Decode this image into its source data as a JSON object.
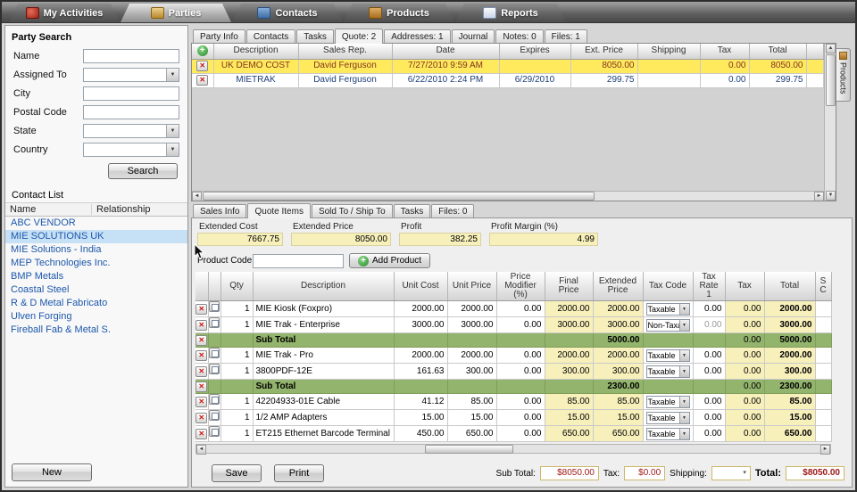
{
  "app": {
    "nav_tabs": [
      {
        "label": "My Activities",
        "icon": "activities-icon",
        "active": false
      },
      {
        "label": "Parties",
        "icon": "parties-icon",
        "active": true
      },
      {
        "label": "Contacts",
        "icon": "contacts-icon",
        "active": false
      },
      {
        "label": "Products",
        "icon": "products-icon",
        "active": false
      },
      {
        "label": "Reports",
        "icon": "reports-icon",
        "active": false
      }
    ]
  },
  "party_search": {
    "title": "Party Search",
    "fields": [
      {
        "label": "Name",
        "type": "text",
        "value": ""
      },
      {
        "label": "Assigned To",
        "type": "combo",
        "value": ""
      },
      {
        "label": "City",
        "type": "text",
        "value": ""
      },
      {
        "label": "Postal Code",
        "type": "text",
        "value": ""
      },
      {
        "label": "State",
        "type": "combo",
        "value": ""
      },
      {
        "label": "Country",
        "type": "combo",
        "value": ""
      }
    ],
    "search_label": "Search"
  },
  "contact_list": {
    "title": "Contact List",
    "columns": [
      "Name",
      "Relationship"
    ],
    "items": [
      {
        "name": "ABC VENDOR",
        "selected": false
      },
      {
        "name": "MIE SOLUTIONS UK",
        "selected": true
      },
      {
        "name": "MIE Solutions - India",
        "selected": false
      },
      {
        "name": "MEP Technologies Inc.",
        "selected": false
      },
      {
        "name": "BMP Metals",
        "selected": false
      },
      {
        "name": "Coastal Steel",
        "selected": false
      },
      {
        "name": "R & D Metal Fabricato",
        "selected": false
      },
      {
        "name": "Ulven Forging",
        "selected": false
      },
      {
        "name": "Fireball Fab & Metal S.",
        "selected": false
      }
    ],
    "new_label": "New"
  },
  "detail_tabs": [
    {
      "label": "Party Info",
      "active": false
    },
    {
      "label": "Contacts",
      "active": false
    },
    {
      "label": "Tasks",
      "active": false
    },
    {
      "label": "Quote: 2",
      "active": true
    },
    {
      "label": "Addresses: 1",
      "active": false
    },
    {
      "label": "Journal",
      "active": false
    },
    {
      "label": "Notes: 0",
      "active": false
    },
    {
      "label": "Files: 1",
      "active": false
    }
  ],
  "quotes_grid": {
    "columns": [
      "Description",
      "Sales Rep.",
      "Date",
      "Expires",
      "Ext. Price",
      "Shipping",
      "Tax",
      "Total"
    ],
    "rows": [
      {
        "description": "UK DEMO COST",
        "sales_rep": "David Ferguson",
        "date": "7/27/2010 9:59 AM",
        "expires": "",
        "ext_price": "8050.00",
        "shipping": "",
        "tax": "0.00",
        "total": "8050.00",
        "selected": true
      },
      {
        "description": "MIETRAK",
        "sales_rep": "David Ferguson",
        "date": "6/22/2010 2:24 PM",
        "expires": "6/29/2010",
        "ext_price": "299.75",
        "shipping": "",
        "tax": "0.00",
        "total": "299.75",
        "selected": false
      }
    ]
  },
  "products_tab_label": "Products",
  "sub_tabs": [
    {
      "label": "Sales Info",
      "active": false
    },
    {
      "label": "Quote Items",
      "active": true
    },
    {
      "label": "Sold To / Ship To",
      "active": false
    },
    {
      "label": "Tasks",
      "active": false
    },
    {
      "label": "Files: 0",
      "active": false
    }
  ],
  "summary": [
    {
      "label": "Extended Cost",
      "value": "7667.75"
    },
    {
      "label": "Extended Price",
      "value": "8050.00"
    },
    {
      "label": "Profit",
      "value": "382.25"
    },
    {
      "label": "Profit Margin (%)",
      "value": "4.99"
    }
  ],
  "product_code": {
    "label": "Product Code",
    "value": "",
    "add_label": "Add Product"
  },
  "items_grid": {
    "columns": [
      "Qty",
      "Description",
      "Unit Cost",
      "Unit Price",
      "Price Modifier (%)",
      "Final Price",
      "Extended Price",
      "Tax Code",
      "Tax Rate 1",
      "Tax",
      "Total",
      "S C"
    ],
    "rows": [
      {
        "type": "item",
        "qty": "1",
        "description": "MIE Kiosk (Foxpro)",
        "unit_cost": "2000.00",
        "unit_price": "2000.00",
        "price_modifier": "0.00",
        "final_price": "2000.00",
        "extended_price": "2000.00",
        "tax_code": "Taxable",
        "tax_rate": "0.00",
        "tax": "0.00",
        "total": "2000.00"
      },
      {
        "type": "item",
        "qty": "1",
        "description": "MIE Trak - Enterprise",
        "unit_cost": "3000.00",
        "unit_price": "3000.00",
        "price_modifier": "0.00",
        "final_price": "3000.00",
        "extended_price": "3000.00",
        "tax_code": "Non-Taxab",
        "tax_rate": "0.00",
        "tax_rate_disabled": true,
        "tax": "0.00",
        "total": "3000.00"
      },
      {
        "type": "subtotal",
        "label": "Sub Total",
        "extended_price": "5000.00",
        "tax": "0.00",
        "total": "5000.00"
      },
      {
        "type": "item",
        "qty": "1",
        "description": "MIE Trak - Pro",
        "unit_cost": "2000.00",
        "unit_price": "2000.00",
        "price_modifier": "0.00",
        "final_price": "2000.00",
        "extended_price": "2000.00",
        "tax_code": "Taxable",
        "tax_rate": "0.00",
        "tax": "0.00",
        "total": "2000.00"
      },
      {
        "type": "item",
        "qty": "1",
        "description": "3800PDF-12E",
        "unit_cost": "161.63",
        "unit_price": "300.00",
        "price_modifier": "0.00",
        "final_price": "300.00",
        "extended_price": "300.00",
        "tax_code": "Taxable",
        "tax_rate": "0.00",
        "tax": "0.00",
        "total": "300.00"
      },
      {
        "type": "subtotal",
        "label": "Sub Total",
        "extended_price": "2300.00",
        "tax": "0.00",
        "total": "2300.00"
      },
      {
        "type": "item",
        "qty": "1",
        "description": "42204933-01E Cable",
        "unit_cost": "41.12",
        "unit_price": "85.00",
        "price_modifier": "0.00",
        "final_price": "85.00",
        "extended_price": "85.00",
        "tax_code": "Taxable",
        "tax_rate": "0.00",
        "tax": "0.00",
        "total": "85.00"
      },
      {
        "type": "item",
        "qty": "1",
        "description": "1/2 AMP Adapters",
        "unit_cost": "15.00",
        "unit_price": "15.00",
        "price_modifier": "0.00",
        "final_price": "15.00",
        "extended_price": "15.00",
        "tax_code": "Taxable",
        "tax_rate": "0.00",
        "tax": "0.00",
        "total": "15.00"
      },
      {
        "type": "item",
        "qty": "1",
        "description": "ET215 Ethernet Barcode Terminal",
        "unit_cost": "450.00",
        "unit_price": "650.00",
        "price_modifier": "0.00",
        "final_price": "650.00",
        "extended_price": "650.00",
        "tax_code": "Taxable",
        "tax_rate": "0.00",
        "tax": "0.00",
        "total": "650.00"
      }
    ]
  },
  "footer": {
    "save_label": "Save",
    "print_label": "Print",
    "sub_total_label": "Sub Total:",
    "sub_total": "$8050.00",
    "tax_label": "Tax:",
    "tax": "$0.00",
    "shipping_label": "Shipping:",
    "shipping": "",
    "total_label": "Total:",
    "total": "$8050.00"
  },
  "colors": {
    "selected_row": "#ffe95c",
    "money_cell": "#f8f0bb",
    "subtotal_row": "#93b46c",
    "contact_link": "#1c57ac",
    "money_value_text": "#9c1515"
  }
}
